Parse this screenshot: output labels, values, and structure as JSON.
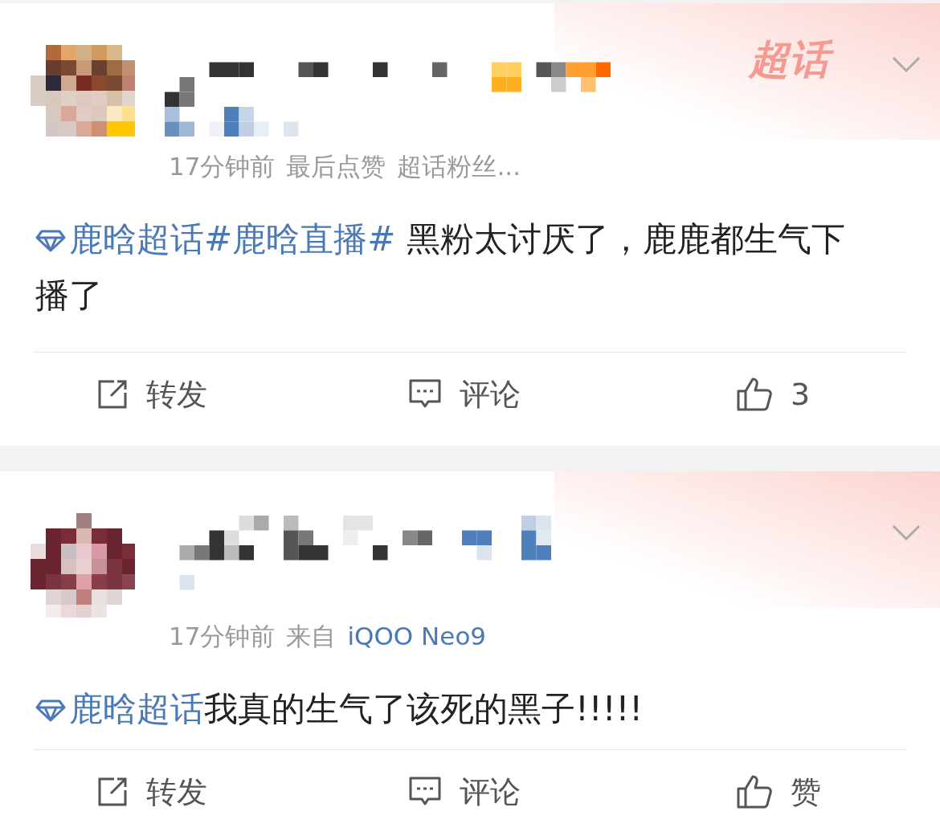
{
  "posts": [
    {
      "badge_text": "超话",
      "meta": [
        {
          "kind": "text",
          "text": "17分钟前"
        },
        {
          "kind": "text",
          "text": "最后点赞"
        },
        {
          "kind": "text",
          "text": "超话粉丝..."
        }
      ],
      "content": [
        {
          "kind": "super_topic",
          "text": "鹿晗超话"
        },
        {
          "kind": "hashtag",
          "text": "#鹿晗直播#"
        },
        {
          "kind": "text",
          "text": " 黑粉太讨厌了，鹿鹿都生气下播了"
        }
      ],
      "actions": [
        {
          "kind": "repost",
          "text": "转发"
        },
        {
          "kind": "comment",
          "text": "评论"
        },
        {
          "kind": "like",
          "text": "3"
        }
      ]
    },
    {
      "meta": [
        {
          "kind": "text",
          "text": "17分钟前"
        },
        {
          "kind": "text",
          "text": "来自"
        },
        {
          "kind": "link",
          "text": "iQOO Neo9"
        }
      ],
      "content": [
        {
          "kind": "super_topic",
          "text": "鹿晗超话"
        },
        {
          "kind": "text",
          "text": "我真的生气了该死的黑子!!!!!"
        }
      ],
      "actions": [
        {
          "kind": "repost",
          "text": "转发"
        },
        {
          "kind": "comment",
          "text": "评论"
        },
        {
          "kind": "like",
          "text": "赞"
        }
      ]
    }
  ]
}
